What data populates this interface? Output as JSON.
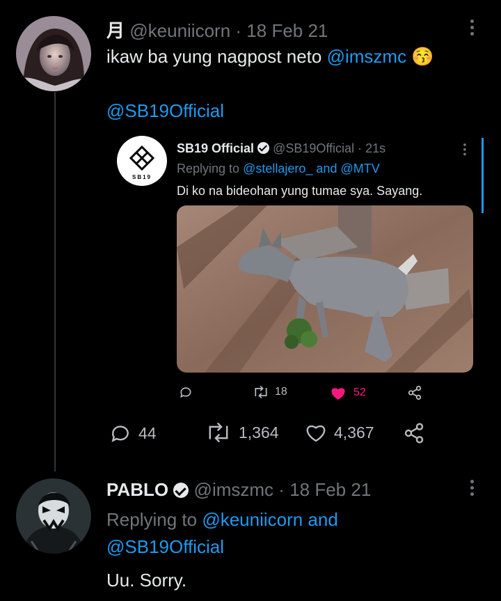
{
  "tweet1": {
    "display_name": "月",
    "handle": "@keuniicorn",
    "separator": "·",
    "date": "18 Feb 21",
    "text": "ikaw ba yung nagpost neto",
    "mention": "@imszmc",
    "emoji": "😚",
    "mention2": "@SB19Official",
    "stats": {
      "replies": "44",
      "retweets": "1,364",
      "likes": "4,367"
    }
  },
  "quoted": {
    "display_name": "SB19 Official",
    "handle": "@SB19Official",
    "separator": "·",
    "time": "21s",
    "replying_prefix": "Replying to",
    "replying_to1": "@stellajero_",
    "replying_and": "and",
    "replying_to2": "@MTV",
    "text": "Di ko na bideohan yung tumae sya. Sayang.",
    "retweets": "18",
    "likes": "52",
    "logo_text": "SB19",
    "colors": {
      "like": "#f91880"
    }
  },
  "tweet2": {
    "display_name": "PABLO",
    "handle": "@imszmc",
    "separator": "·",
    "date": "18 Feb 21",
    "replying_prefix": "Replying to",
    "replying_to1": "@keuniicorn",
    "replying_and": "and",
    "replying_to2": "@SB19Official",
    "text": "Uu. Sorry."
  },
  "colors": {
    "link": "#1d9bf0",
    "muted": "#71767b",
    "text": "#e7e9ea",
    "background": "#000000"
  },
  "icons": [
    "reply-icon",
    "retweet-icon",
    "like-icon",
    "share-icon",
    "more-icon",
    "verified-badge-icon"
  ]
}
